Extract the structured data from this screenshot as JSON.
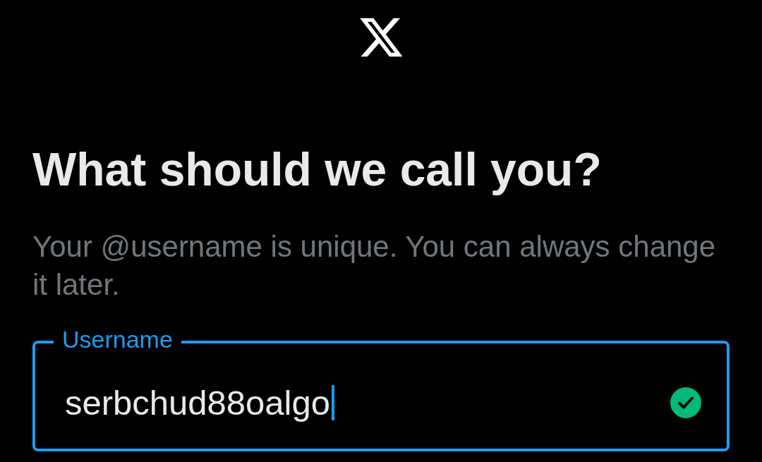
{
  "heading": "What should we call you?",
  "description": "Your @username is unique. You can always change it later.",
  "username_field": {
    "label": "Username",
    "value": "serbchud88oalgo",
    "focused": true,
    "valid": true
  }
}
